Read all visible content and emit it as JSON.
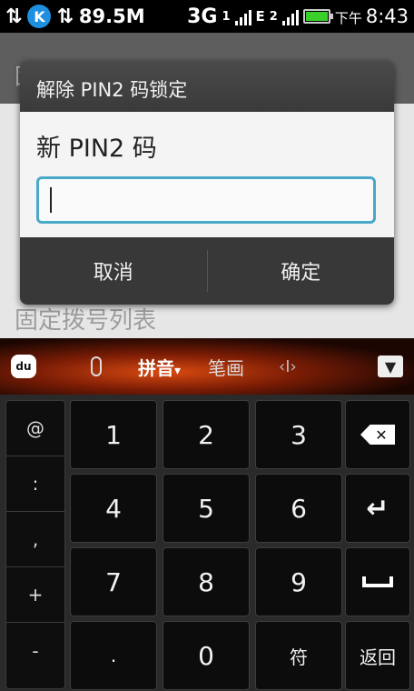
{
  "status_bar": {
    "k_badge": "K",
    "data_speed": "89.5M",
    "network_3g": "3G",
    "network_e": "E",
    "network_label_1": "1",
    "network_label_2": "2",
    "time_prefix": "下午",
    "time": "8:43"
  },
  "background": {
    "title": "固定拨号",
    "hint": "固定拨号列表"
  },
  "dialog": {
    "title": "解除 PIN2 码锁定",
    "field_label": "新 PIN2 码",
    "input_value": "",
    "cancel_label": "取消",
    "ok_label": "确定"
  },
  "ime": {
    "logo": "du",
    "pinyin_label": "拼音",
    "pinyin_arrow": "▾",
    "stroke_label": "笔画",
    "cursor_label": "‹I›"
  },
  "keyboard": {
    "symbols": [
      "@",
      ":",
      ",",
      "+",
      "-"
    ],
    "keys": {
      "k1": "1",
      "k2": "2",
      "k3": "3",
      "k4": "4",
      "k5": "5",
      "k6": "6",
      "k7": "7",
      "k8": "8",
      "k9": "9",
      "dot": ".",
      "k0": "0",
      "symbol": "符",
      "back": "返回"
    }
  },
  "colors": {
    "input_border": "#4aa8c9",
    "battery": "#39d02a",
    "k_badge": "#1f8fe0"
  }
}
